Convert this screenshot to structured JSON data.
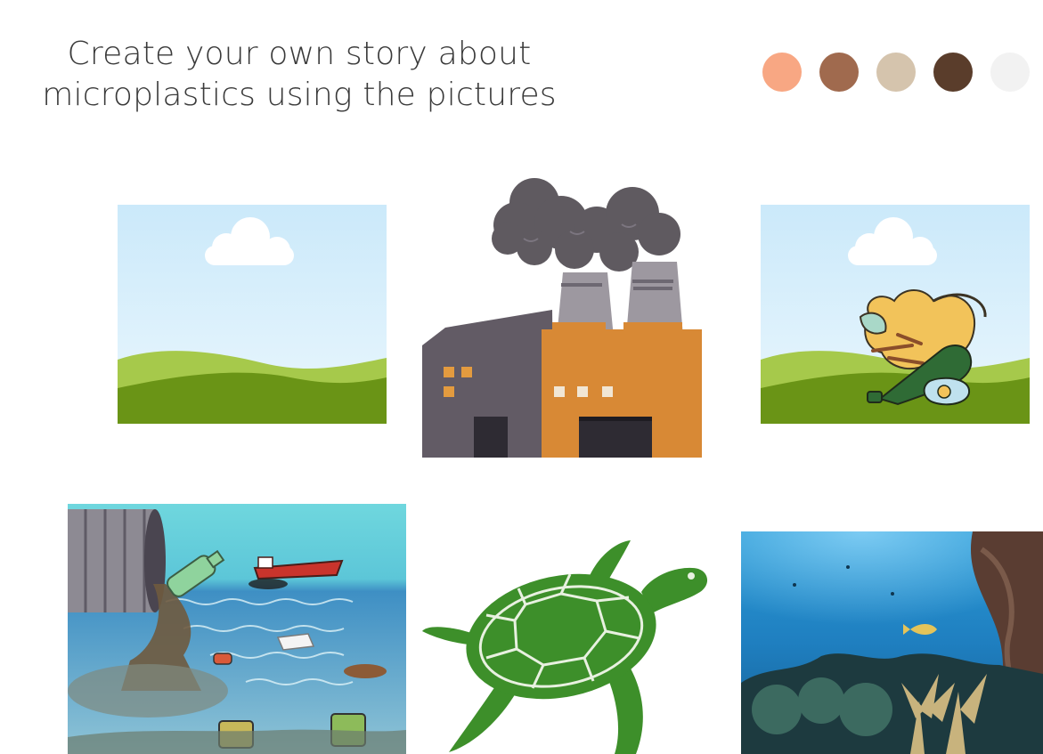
{
  "title": {
    "line1": "Create your own story about",
    "line2": "microplastics using the pictures"
  },
  "palette": [
    "#f8a783",
    "#a06a4e",
    "#d5c4ad",
    "#5a3d2b",
    "#f2f2f2"
  ],
  "pictures": [
    {
      "id": "landscape",
      "icon": "landscape-scene"
    },
    {
      "id": "factory",
      "icon": "factory-illustration"
    },
    {
      "id": "landscape-with-trash",
      "icon": "landscape-trash-scene"
    },
    {
      "id": "polluted-sea",
      "icon": "sewage-pipe-ocean-pollution"
    },
    {
      "id": "sea-turtle",
      "icon": "sea-turtle"
    },
    {
      "id": "coral-reef",
      "icon": "underwater-coral-reef"
    }
  ]
}
